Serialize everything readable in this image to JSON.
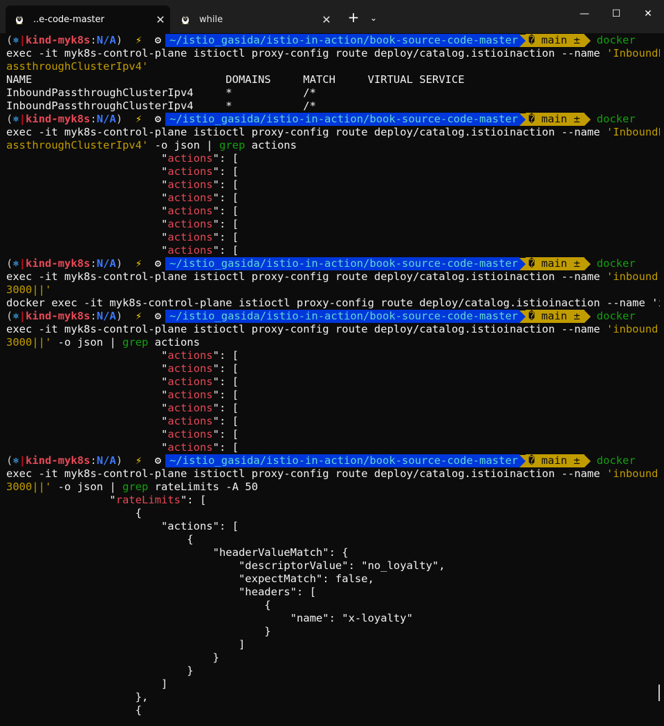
{
  "tabs": [
    {
      "title": "..e-code-master",
      "close": "✕"
    },
    {
      "title": "while",
      "close": "✕"
    }
  ],
  "tabbar": {
    "new_tab": "+",
    "dropdown": "⌄"
  },
  "window": {
    "minimize": "—",
    "maximize": "☐",
    "close": "✕"
  },
  "prompt": {
    "open": "(",
    "k8s_icon": "⎈",
    "bar": "|",
    "context": "kind-myk8s",
    "colon": ":",
    "namespace": "N/A",
    "close": ")",
    "bolt": "⚡",
    "gear": "⚙",
    "path": "~/istio_gasida/istio-in-action/book-source-code-master",
    "git": "� main ±",
    "cmd": "docker"
  },
  "blocks": {
    "b1": {
      "cmd1": "exec -it myk8s-control-plane istioctl proxy-config route deploy/catalog.istioinaction --name ",
      "str1": "'InboundP",
      "str2": "assthroughClusterIpv4'",
      "header": "NAME                              DOMAINS     MATCH     VIRTUAL SERVICE",
      "row1": "InboundPassthroughClusterIpv4     *           /*",
      "row2": "InboundPassthroughClusterIpv4     *           /*"
    },
    "b2": {
      "cmd1": "exec -it myk8s-control-plane istioctl proxy-config route deploy/catalog.istioinaction --name ",
      "str1": "'InboundP",
      "str2": "assthroughClusterIpv4'",
      "rest1": " -o json | ",
      "grep": "grep",
      "rest2": " actions"
    },
    "b3": {
      "cmd1": "exec -it myk8s-control-plane istioctl proxy-config route deploy/catalog.istioinaction --name ",
      "str1": "'inbound|",
      "str2": "3000||'",
      "echo": "docker exec -it myk8s-control-plane istioctl proxy-config route deploy/catalog.istioinaction --name 'i"
    },
    "b4": {
      "cmd1": "exec -it myk8s-control-plane istioctl proxy-config route deploy/catalog.istioinaction --name ",
      "str1": "'inbound|",
      "str2": "3000||'",
      "rest1": " -o json | ",
      "grep": "grep",
      "rest2": " actions"
    },
    "b5": {
      "cmd1": "exec -it myk8s-control-plane istioctl proxy-config route deploy/catalog.istioinaction --name ",
      "str1": "'inbound|",
      "str2": "3000||'",
      "rest1": " -o json | ",
      "grep": "grep",
      "rest2": " rateLimits -A 50"
    }
  },
  "json": {
    "indent": "                        ",
    "q": "\"",
    "actions": "actions",
    "after": "\": [",
    "rateLimits": "rateLimits",
    "l_rl_pre": "                \"",
    "l_rl_post": "\": [",
    "l_open_obj": "                    {",
    "l_actions": "                        \"actions\": [",
    "l_open_obj2": "                            {",
    "l_hvm": "                                \"headerValueMatch\": {",
    "l_desc": "                                    \"descriptorValue\": \"no_loyalty\",",
    "l_expect": "                                    \"expectMatch\": false,",
    "l_headers": "                                    \"headers\": [",
    "l_open_obj3": "                                        {",
    "l_name": "                                            \"name\": \"x-loyalty\"",
    "l_close_obj3": "                                        }",
    "l_close_arr": "                                    ]",
    "l_close_hvm": "                                }",
    "l_close_obj2": "                            }",
    "l_close_actions": "                        ]",
    "l_close_obj": "                    },",
    "l_open_next": "                    {"
  },
  "colors": {
    "background": "#0c0c0c",
    "path_segment": "#0037da",
    "git_segment": "#c19c00",
    "key_red": "#e74856",
    "string_gold": "#c19c00",
    "command_green": "#13a10e"
  }
}
